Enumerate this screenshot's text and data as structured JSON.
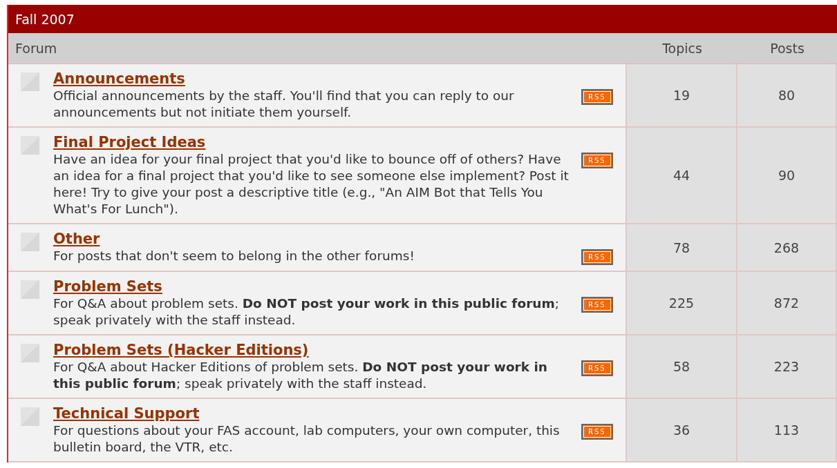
{
  "category": {
    "title": "Fall 2007"
  },
  "columns": [
    "Forum",
    "Topics",
    "Posts"
  ],
  "forums": [
    {
      "name": "Announcements",
      "description": "Official announcements by the staff. You'll find that you can reply to our announcements but not initiate them yourself.",
      "rss": "RSS",
      "topics": "19",
      "posts": "80"
    },
    {
      "name": "Final Project Ideas",
      "description": "Have an idea for your final project that you'd like to bounce off of others? Have an idea for a final project that you'd like to see someone else implement? Post it here! Try to give your post a descriptive title (e.g., \"An AIM Bot that Tells You What's For Lunch\").",
      "rss": "RSS",
      "topics": "44",
      "posts": "90"
    },
    {
      "name": "Other",
      "description": "For posts that don't seem to belong in the other forums!",
      "rss": "RSS",
      "topics": "78",
      "posts": "268"
    },
    {
      "name": "Problem Sets",
      "description": "For Q&A about problem sets. **Do NOT post your work in this public forum**; speak privately with the staff instead.",
      "rss": "RSS",
      "topics": "225",
      "posts": "872"
    },
    {
      "name": "Problem Sets (Hacker Editions)",
      "description": "For Q&A about Hacker Editions of problem sets. **Do NOT post your work in this public forum**; speak privately with the staff instead.",
      "rss": "RSS",
      "topics": "58",
      "posts": "223"
    },
    {
      "name": "Technical Support",
      "description": "For questions about your FAS account, lab computers, your own computer, this bulletin board, the VTR, etc.",
      "rss": "RSS",
      "topics": "36",
      "posts": "113"
    }
  ]
}
